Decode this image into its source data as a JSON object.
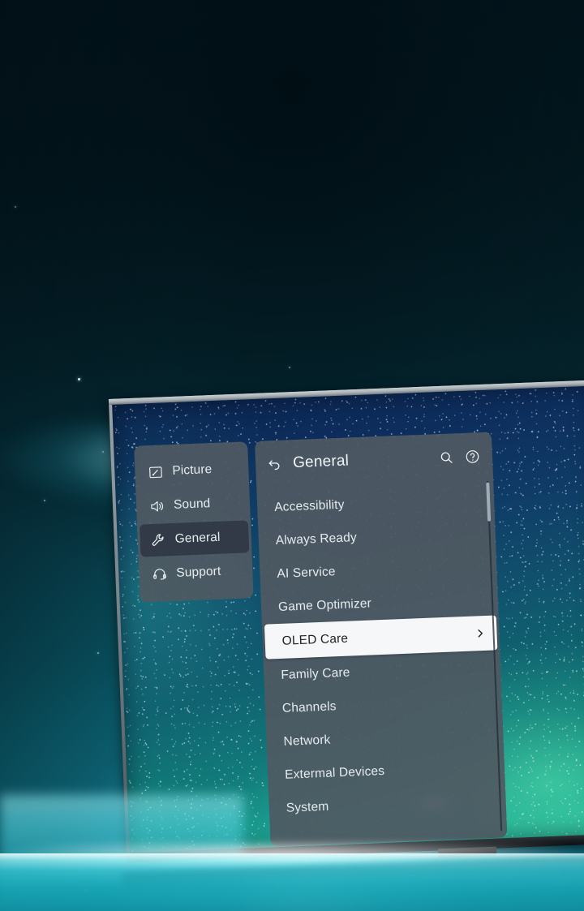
{
  "scene": {
    "device": "OLED TV",
    "wallpaper_name": "starfield-nebula-wallpaper",
    "backdrop_accent": "#12a5b8",
    "glow_color": "#bdfaff"
  },
  "settings": {
    "panel_bg": "#4f5962",
    "text_color": "#e9edf0",
    "sidebar": {
      "items": [
        {
          "label": "Picture",
          "icon": "picture-icon",
          "selected": false
        },
        {
          "label": "Sound",
          "icon": "sound-icon",
          "selected": false
        },
        {
          "label": "General",
          "icon": "wrench-icon",
          "selected": true
        },
        {
          "label": "Support",
          "icon": "headset-icon",
          "selected": false
        }
      ]
    },
    "header": {
      "back_label": "Back",
      "title": "General",
      "search_label": "Search",
      "help_label": "Help"
    },
    "menu": {
      "items": [
        {
          "label": "Accessibility",
          "active": false,
          "has_chevron": false
        },
        {
          "label": "Always Ready",
          "active": false,
          "has_chevron": false
        },
        {
          "label": "AI Service",
          "active": false,
          "has_chevron": false
        },
        {
          "label": "Game Optimizer",
          "active": false,
          "has_chevron": false
        },
        {
          "label": "OLED Care",
          "active": true,
          "has_chevron": true
        },
        {
          "label": "Family Care",
          "active": false,
          "has_chevron": false
        },
        {
          "label": "Channels",
          "active": false,
          "has_chevron": false
        },
        {
          "label": "Network",
          "active": false,
          "has_chevron": false
        },
        {
          "label": "Extermal Devices",
          "active": false,
          "has_chevron": false
        },
        {
          "label": "System",
          "active": false,
          "has_chevron": false
        }
      ],
      "highlight_bg": "#f5f7f8",
      "highlight_text": "#1d2226"
    },
    "scrollbar": {
      "thumb_top_pct": 1,
      "thumb_height_pct": 11
    }
  }
}
